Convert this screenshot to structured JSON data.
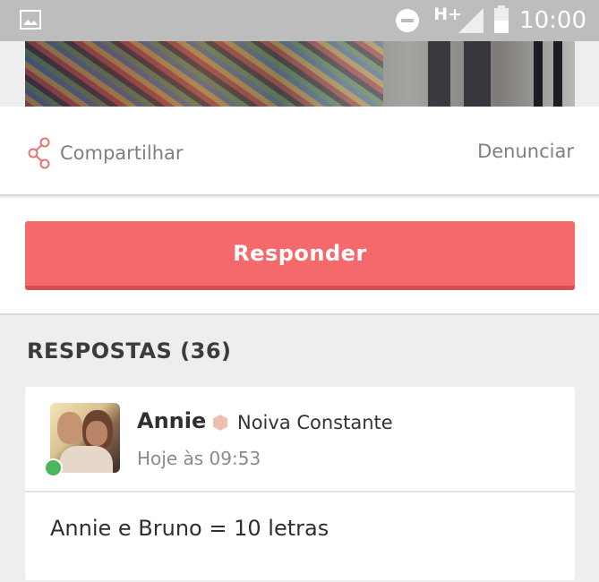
{
  "status_bar": {
    "gallery_icon": "image-icon",
    "dnd_icon": "do-not-disturb-icon",
    "network": "H+",
    "signal_icon": "signal-icon",
    "battery_icon": "battery-icon",
    "time": "10:00"
  },
  "actions": {
    "share_icon": "share-icon",
    "share_label": "Compartilhar",
    "report_label": "Denunciar"
  },
  "reply": {
    "button_label": "Responder",
    "color": "#f4696b"
  },
  "answers": {
    "heading": "RESPOSTAS (36)",
    "items": [
      {
        "author": "Annie",
        "badge_icon": "hexagon-badge-icon",
        "rank": "Noiva Constante",
        "time": "Hoje às 09:53",
        "online": true,
        "text": "Annie e Bruno = 10 letras"
      }
    ]
  },
  "colors": {
    "accent": "#f4696b",
    "online": "#4bb65a",
    "badge": "#ecc0ad"
  }
}
